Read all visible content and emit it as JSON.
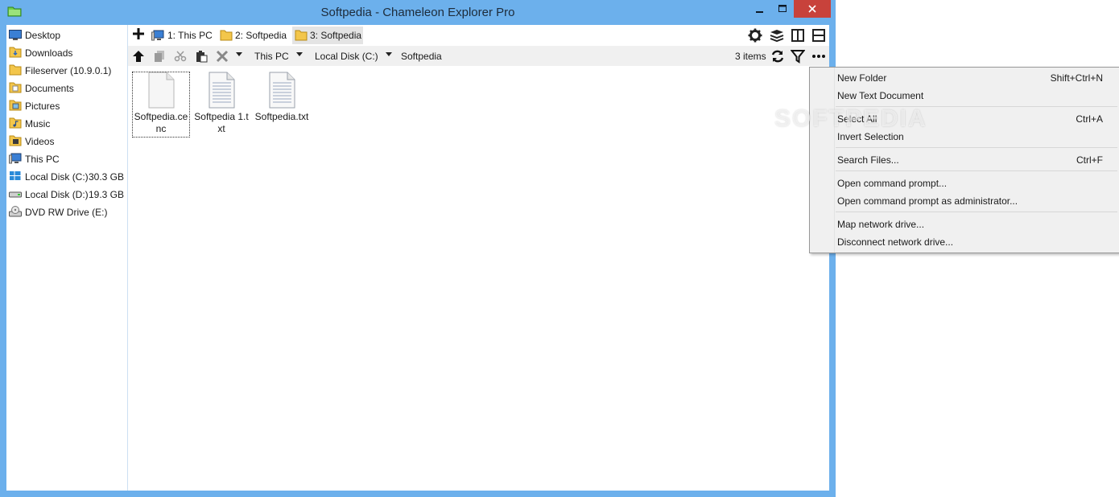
{
  "window": {
    "title": "Softpedia - Chameleon Explorer Pro"
  },
  "sidebar": {
    "items": [
      {
        "label": "Desktop",
        "icon": "desktop-icon",
        "size": ""
      },
      {
        "label": "Downloads",
        "icon": "downloads-folder-icon",
        "size": ""
      },
      {
        "label": "Fileserver (10.9.0.1)",
        "icon": "folder-icon",
        "size": ""
      },
      {
        "label": "Documents",
        "icon": "documents-folder-icon",
        "size": ""
      },
      {
        "label": "Pictures",
        "icon": "pictures-folder-icon",
        "size": ""
      },
      {
        "label": "Music",
        "icon": "music-folder-icon",
        "size": ""
      },
      {
        "label": "Videos",
        "icon": "videos-folder-icon",
        "size": ""
      },
      {
        "label": "This PC",
        "icon": "computer-icon",
        "size": ""
      },
      {
        "label": "Local Disk (C:)",
        "icon": "windows-drive-icon",
        "size": "30.3 GB"
      },
      {
        "label": "Local Disk (D:)",
        "icon": "drive-icon",
        "size": "19.3 GB"
      },
      {
        "label": "DVD RW Drive (E:)",
        "icon": "dvd-drive-icon",
        "size": ""
      }
    ]
  },
  "tabs": [
    {
      "label": "1: This PC",
      "icon": "computer-icon",
      "active": false
    },
    {
      "label": "2: Softpedia",
      "icon": "folder-icon",
      "active": false
    },
    {
      "label": "3: Softpedia",
      "icon": "folder-icon",
      "active": true
    }
  ],
  "toolbar": {
    "tab_buttons": [
      "settings-icon",
      "layers-icon",
      "split-vertical-icon",
      "split-horizontal-icon"
    ],
    "path_buttons": [
      "up-arrow-icon",
      "copy-icon",
      "cut-icon",
      "paste-icon",
      "delete-icon"
    ],
    "right_buttons": [
      "refresh-icon",
      "filter-icon",
      "more-icon"
    ]
  },
  "breadcrumb": [
    "This PC",
    "Local Disk (C:)",
    "Softpedia"
  ],
  "status": {
    "items_count": "3 items"
  },
  "files": [
    {
      "name": "Softpedia.ce nc",
      "icon": "blank-file-icon",
      "selected": true
    },
    {
      "name": "Softpedia 1.txt",
      "icon": "text-file-icon",
      "selected": false
    },
    {
      "name": "Softpedia.txt",
      "icon": "text-file-icon",
      "selected": false
    }
  ],
  "context_menu": {
    "items": [
      {
        "label": "New Folder",
        "shortcut": "Shift+Ctrl+N"
      },
      {
        "label": "New Text Document",
        "shortcut": ""
      },
      {
        "label": "Select All",
        "shortcut": "Ctrl+A"
      },
      {
        "label": "Invert Selection",
        "shortcut": ""
      },
      {
        "label": "Search Files...",
        "shortcut": "Ctrl+F"
      },
      {
        "label": "Open command prompt...",
        "shortcut": ""
      },
      {
        "label": "Open command prompt as administrator...",
        "shortcut": ""
      },
      {
        "label": "Map network drive...",
        "shortcut": ""
      },
      {
        "label": "Disconnect network drive...",
        "shortcut": ""
      }
    ]
  },
  "watermark": {
    "text": "SOFTPEDIA"
  },
  "colors": {
    "window_frame": "#6cb0ec",
    "close_button": "#c8423b",
    "menu_bg": "#f0f0f0",
    "folder": "#f3c64b"
  }
}
